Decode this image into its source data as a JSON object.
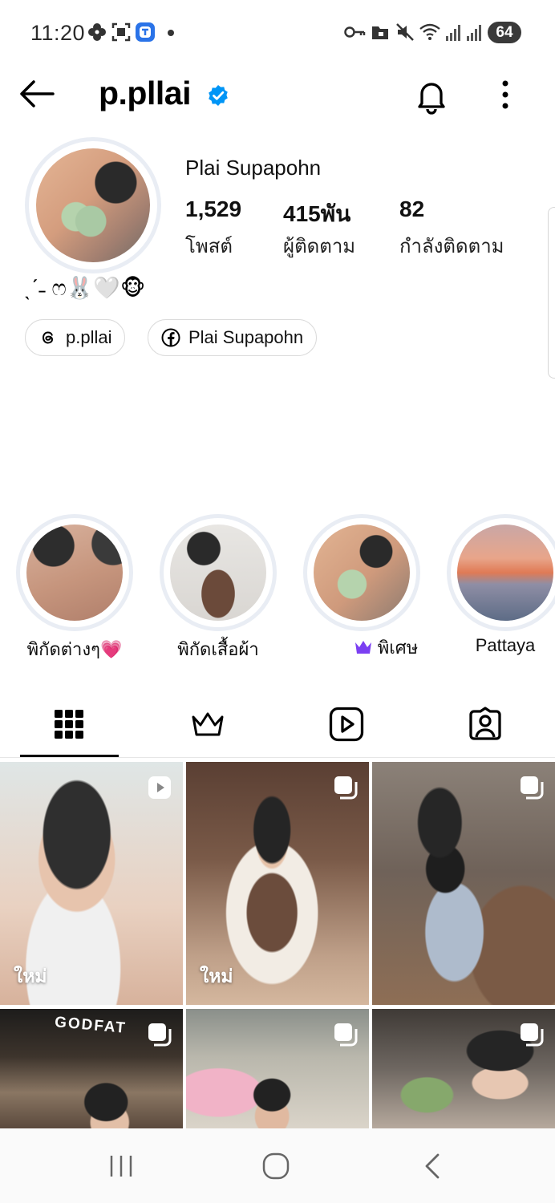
{
  "status_bar": {
    "time": "11:20",
    "battery": "64"
  },
  "header": {
    "username": "p.pllai",
    "verified": true
  },
  "profile": {
    "full_name": "Plai Supapohn",
    "stats": [
      {
        "value": "1,529",
        "label": "โพสต์"
      },
      {
        "value": "415พัน",
        "label": "ผู้ติดตาม"
      },
      {
        "value": "82",
        "label": "กำลังติดตาม"
      }
    ],
    "bio": "ˎˊ˗ ෆ🐰🤍🐵",
    "links": [
      {
        "label": "p.pllai",
        "icon": "threads-icon"
      },
      {
        "label": "Plai Supapohn",
        "icon": "facebook-icon"
      }
    ]
  },
  "highlights": [
    {
      "label": "พิกัดต่างๆ💗"
    },
    {
      "label": "พิกัดเสื้อผ้า"
    },
    {
      "label": "พิเศษ",
      "icon": "crown-icon",
      "icon_color": "#7b3ff2"
    },
    {
      "label": "Pattaya"
    }
  ],
  "tabs": [
    {
      "icon": "grid-icon",
      "active": true
    },
    {
      "icon": "crown-icon",
      "active": false
    },
    {
      "icon": "reels-icon",
      "active": false
    },
    {
      "icon": "tagged-icon",
      "active": false
    }
  ],
  "grid": [
    {
      "badge": "reel-icon",
      "label": "ใหม่"
    },
    {
      "badge": "multi-post-icon",
      "label": "ใหม่"
    },
    {
      "badge": "multi-post-icon",
      "label": ""
    },
    {
      "badge": "multi-post-icon",
      "label": ""
    },
    {
      "badge": "multi-post-icon",
      "label": ""
    },
    {
      "badge": "multi-post-icon",
      "label": ""
    }
  ],
  "grid_photo_text": "GODFAT",
  "colors": {
    "verified_blue": "#0095f6",
    "text": "#000000",
    "ring": "#e9edf4"
  }
}
